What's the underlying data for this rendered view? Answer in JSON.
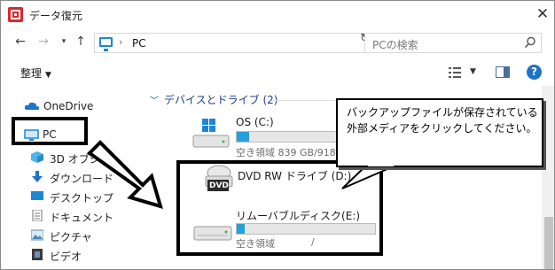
{
  "window": {
    "title": "データ復元"
  },
  "address_bar": {
    "crumb": "PC",
    "search_placeholder": "PCの検索"
  },
  "command_bar": {
    "organize_label": "整理"
  },
  "nav_pane": {
    "items": [
      {
        "label": "OneDrive",
        "icon": "cloud-icon"
      },
      {
        "label": "PC",
        "icon": "computer-icon"
      },
      {
        "label": "3D オブジェ",
        "icon": "cube-icon"
      },
      {
        "label": "ダウンロード",
        "icon": "download-arrow-icon"
      },
      {
        "label": "デスクトップ",
        "icon": "desktop-icon"
      },
      {
        "label": "ドキュメント",
        "icon": "document-icon"
      },
      {
        "label": "ピクチャ",
        "icon": "picture-icon"
      },
      {
        "label": "ビデオ",
        "icon": "video-icon"
      }
    ]
  },
  "content": {
    "group_header": "デバイスとドライブ (2)",
    "drives": [
      {
        "name": "OS (C:)",
        "info": "空き領域 839 GB/918",
        "used_fraction": 0.09,
        "icon": "windows-drive-icon"
      },
      {
        "name": "DVD RW ドライブ (D:)",
        "icon": "dvd-drive-icon",
        "badge": "DVD"
      },
      {
        "name": "リムーバブルディスク(E:)",
        "info": "空き領域",
        "info_sep": "/",
        "used_fraction": 0.06,
        "icon": "removable-drive-icon"
      }
    ]
  },
  "callout": {
    "text": "バックアップファイルが保存されている外部メディアをクリックしてください。"
  },
  "colors": {
    "accent": "#26a0da",
    "brand_red": "#e0262a",
    "group_header": "#1a3f8e",
    "annotation": "#000000"
  }
}
